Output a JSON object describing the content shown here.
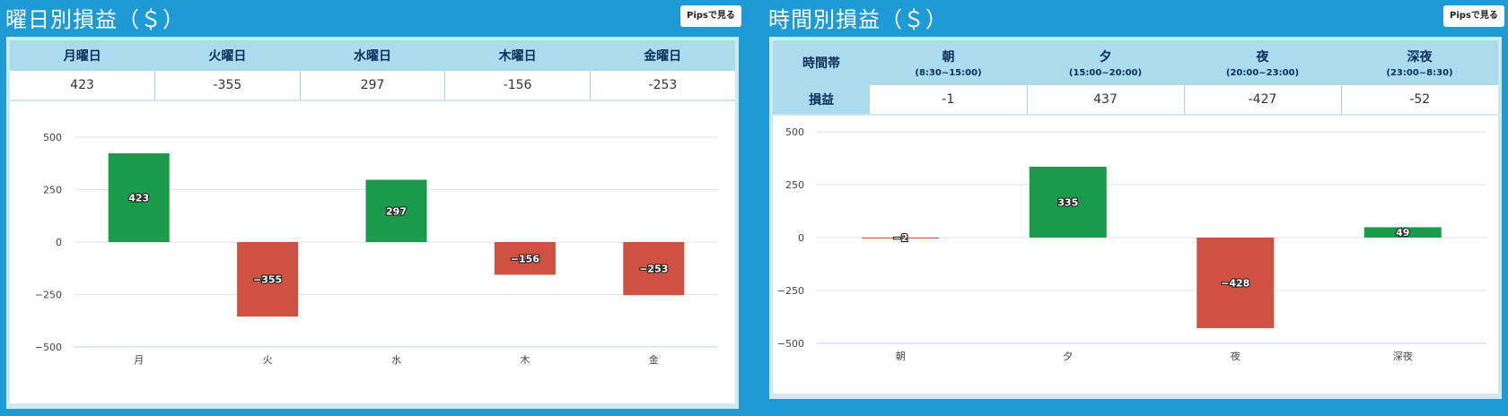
{
  "left": {
    "title": "曜日別損益（＄）",
    "pips_button": "Pipsで見る",
    "table": {
      "headers": [
        "月曜日",
        "火曜日",
        "水曜日",
        "木曜日",
        "金曜日"
      ],
      "values": [
        "423",
        "-355",
        "297",
        "-156",
        "-253"
      ]
    },
    "chart_data": {
      "type": "bar",
      "categories": [
        "月",
        "火",
        "水",
        "木",
        "金"
      ],
      "values": [
        423,
        -355,
        297,
        -156,
        -253
      ],
      "data_labels": [
        "423",
        "−355",
        "297",
        "−156",
        "−253"
      ],
      "yticks": [
        "500",
        "250",
        "0",
        "−250",
        "−500"
      ],
      "ylim": [
        -500,
        500
      ],
      "grid": true
    }
  },
  "right": {
    "title": "時間別損益（＄）",
    "pips_button": "Pipsで見る",
    "table": {
      "row_header": "時間帯",
      "value_header": "損益",
      "headers": [
        {
          "name": "朝",
          "range": "(8:30~15:00)"
        },
        {
          "name": "夕",
          "range": "(15:00~20:00)"
        },
        {
          "name": "夜",
          "range": "(20:00~23:00)"
        },
        {
          "name": "深夜",
          "range": "(23:00~8:30)"
        }
      ],
      "values": [
        "-1",
        "437",
        "-427",
        "-52"
      ]
    },
    "chart_data": {
      "type": "bar",
      "categories": [
        "朝",
        "夕",
        "夜",
        "深夜"
      ],
      "values": [
        -2,
        335,
        -428,
        49
      ],
      "data_labels": [
        "−2",
        "335",
        "−428",
        "49"
      ],
      "yticks": [
        "500",
        "250",
        "0",
        "−250",
        "−500"
      ],
      "ylim": [
        -500,
        500
      ],
      "grid": true
    }
  },
  "colors": {
    "background": "#1e9bd6",
    "positive_bar": "#1a9a4b",
    "negative_bar": "#cf5141",
    "header_fill": "#aadcee",
    "header_text": "#0b2d5a"
  }
}
